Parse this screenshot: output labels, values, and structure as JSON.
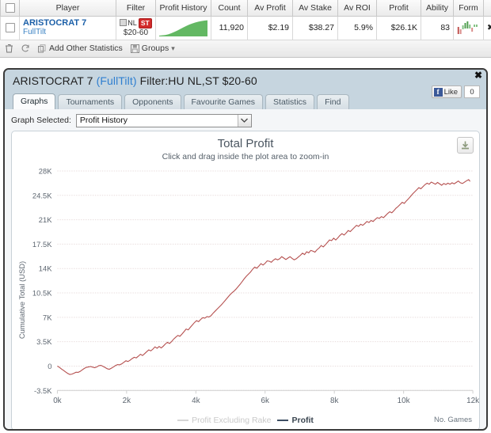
{
  "grid": {
    "columns": [
      "",
      "Player",
      "Filter",
      "Profit History",
      "Count",
      "Av Profit",
      "Av Stake",
      "Av ROI",
      "Profit",
      "Ability",
      "Form",
      ""
    ],
    "row": {
      "player_name": "ARISTOCRAT 7",
      "player_site": "FullTilt",
      "filter_game": "NL",
      "filter_table": "ST",
      "filter_stakes": "$20-60",
      "count": "11,920",
      "av_profit": "$2.19",
      "av_stake": "$38.27",
      "av_roi": "5.9%",
      "profit": "$26.1K",
      "ability": "83",
      "remove_icon": "close-x-icon"
    },
    "toolbar": {
      "delete_icon": "trash-icon",
      "refresh_icon": "refresh-icon",
      "add_stats_icon": "copy-icon",
      "add_stats_label": "Add Other Statistics",
      "groups_icon": "save-icon",
      "groups_label": "Groups",
      "groups_caret": "▾"
    }
  },
  "dialog": {
    "title_player": "ARISTOCRAT 7",
    "title_site": "(FullTilt)",
    "title_filter": "Filter:HU NL,ST $20-60",
    "close_label": "✖",
    "facebook": {
      "icon_letter": "f",
      "like_label": "Like",
      "count": "0"
    },
    "tabs": [
      {
        "label": "Graphs",
        "active": true
      },
      {
        "label": "Tournaments",
        "active": false
      },
      {
        "label": "Opponents",
        "active": false
      },
      {
        "label": "Favourite Games",
        "active": false
      },
      {
        "label": "Statistics",
        "active": false
      },
      {
        "label": "Find",
        "active": false
      }
    ],
    "graph_select_label": "Graph Selected:",
    "graph_select_value": "Profit History",
    "graph_select_caret": "⌄",
    "download_icon": "download-icon"
  },
  "chart_data": {
    "type": "line",
    "title": "Total Profit",
    "subtitle": "Click and drag inside the plot area to zoom-in",
    "xlabel": "No. Games",
    "ylabel": "Cumulative Total (USD)",
    "xlim": [
      0,
      12000
    ],
    "ylim": [
      -3500,
      28000
    ],
    "xticks": [
      0,
      2000,
      4000,
      6000,
      8000,
      10000,
      12000
    ],
    "xticklabels": [
      "0k",
      "2k",
      "4k",
      "6k",
      "8k",
      "10k",
      "12k"
    ],
    "yticks": [
      -3500,
      0,
      3500,
      7000,
      10500,
      14000,
      17500,
      21000,
      24500,
      28000
    ],
    "yticklabels": [
      "-3.5K",
      "0",
      "3.5K",
      "7K",
      "10.5K",
      "14K",
      "17.5K",
      "21K",
      "24.5K",
      "28K"
    ],
    "grid": true,
    "legend_position": "bottom-center",
    "series": [
      {
        "name": "Profit Excluding Rake",
        "color": "#d5d5d5",
        "active": false,
        "values": []
      },
      {
        "name": "Profit",
        "color": "#b5504f",
        "active": true,
        "x": [
          0,
          60,
          120,
          180,
          240,
          300,
          360,
          420,
          480,
          540,
          600,
          660,
          720,
          780,
          840,
          900,
          960,
          1020,
          1080,
          1140,
          1200,
          1260,
          1320,
          1380,
          1440,
          1500,
          1560,
          1620,
          1680,
          1740,
          1800,
          1860,
          1920,
          1980,
          2040,
          2100,
          2160,
          2220,
          2280,
          2340,
          2400,
          2460,
          2520,
          2580,
          2640,
          2700,
          2760,
          2820,
          2880,
          2940,
          3000,
          3060,
          3120,
          3180,
          3240,
          3300,
          3360,
          3420,
          3480,
          3540,
          3600,
          3660,
          3720,
          3780,
          3840,
          3900,
          3960,
          4020,
          4080,
          4140,
          4200,
          4260,
          4320,
          4380,
          4440,
          4500,
          4560,
          4620,
          4680,
          4740,
          4800,
          4860,
          4920,
          4980,
          5040,
          5100,
          5160,
          5220,
          5280,
          5340,
          5400,
          5460,
          5520,
          5580,
          5640,
          5700,
          5760,
          5820,
          5880,
          5940,
          6000,
          6060,
          6120,
          6180,
          6240,
          6300,
          6360,
          6420,
          6480,
          6540,
          6600,
          6660,
          6720,
          6780,
          6840,
          6900,
          6960,
          7020,
          7080,
          7140,
          7200,
          7260,
          7320,
          7380,
          7440,
          7500,
          7560,
          7620,
          7680,
          7740,
          7800,
          7860,
          7920,
          7980,
          8040,
          8100,
          8160,
          8220,
          8280,
          8340,
          8400,
          8460,
          8520,
          8580,
          8640,
          8700,
          8760,
          8820,
          8880,
          8940,
          9000,
          9060,
          9120,
          9180,
          9240,
          9300,
          9360,
          9420,
          9480,
          9540,
          9600,
          9660,
          9720,
          9780,
          9840,
          9900,
          9960,
          10020,
          10080,
          10140,
          10200,
          10260,
          10320,
          10380,
          10440,
          10500,
          10560,
          10620,
          10680,
          10740,
          10800,
          10860,
          10920,
          10980,
          11040,
          11100,
          11160,
          11220,
          11280,
          11340,
          11400,
          11460,
          11520,
          11580,
          11640,
          11700,
          11760,
          11820,
          11880,
          11920
        ],
        "values": [
          0,
          -180,
          -420,
          -620,
          -850,
          -1050,
          -1200,
          -1150,
          -1020,
          -880,
          -900,
          -760,
          -540,
          -330,
          -180,
          -120,
          -60,
          -150,
          -230,
          -120,
          60,
          110,
          -40,
          -200,
          -380,
          -460,
          -300,
          -120,
          80,
          220,
          180,
          320,
          540,
          760,
          660,
          840,
          1080,
          1260,
          1180,
          1420,
          1700,
          1520,
          1780,
          2060,
          2320,
          2180,
          2440,
          2760,
          2560,
          2820,
          2600,
          2860,
          3180,
          3420,
          3240,
          3520,
          3880,
          4150,
          4400,
          4280,
          4600,
          4950,
          5320,
          5200,
          5560,
          5900,
          6250,
          6520,
          6380,
          6700,
          6950,
          6880,
          7100,
          7050,
          7250,
          7600,
          7900,
          8200,
          8500,
          8800,
          9150,
          9500,
          9850,
          10200,
          10500,
          10750,
          11050,
          11400,
          11750,
          12150,
          12550,
          12900,
          13200,
          13500,
          13900,
          14200,
          14050,
          14350,
          14700,
          14500,
          14750,
          15100,
          15050,
          14900,
          15200,
          15400,
          15250,
          15400,
          15700,
          15500,
          15300,
          15500,
          15700,
          15450,
          15250,
          15400,
          15650,
          15900,
          16200,
          16000,
          16400,
          16250,
          16600,
          16500,
          16350,
          16700,
          16950,
          17300,
          17100,
          17400,
          17750,
          18100,
          18000,
          18350,
          18100,
          18400,
          18750,
          19000,
          18800,
          19100,
          19450,
          19300,
          19600,
          19900,
          20200,
          20050,
          20350,
          20200,
          20450,
          20750,
          20600,
          20900,
          20750,
          21050,
          21300,
          21200,
          21450,
          21300,
          21600,
          21900,
          22150,
          22000,
          22300,
          22650,
          22900,
          23200,
          23500,
          23350,
          23700,
          24000,
          24350,
          24700,
          25000,
          25300,
          25600,
          25450,
          25750,
          26050,
          26250,
          26100,
          26400,
          26250,
          26100,
          26350,
          26150,
          25950,
          26200,
          26050,
          26250,
          26100,
          26300,
          26150,
          26350,
          26550,
          26300,
          26200,
          26400,
          26600,
          26750,
          26500,
          26650,
          26800
        ]
      }
    ]
  }
}
